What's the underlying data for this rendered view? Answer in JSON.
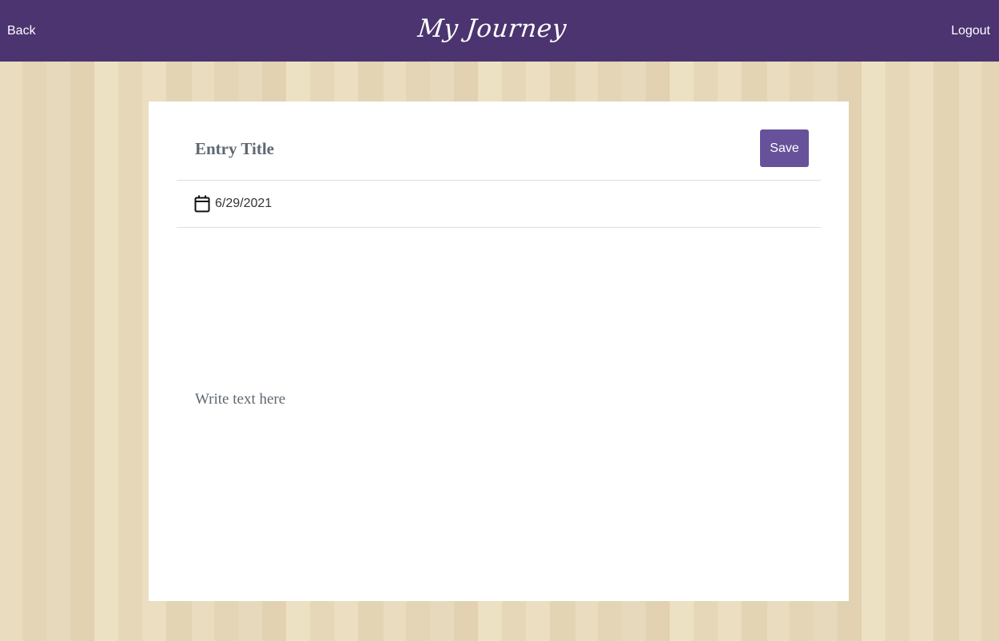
{
  "header": {
    "back_label": "Back",
    "brand": "My Journey",
    "logout_label": "Logout",
    "background_color": "#4b3470"
  },
  "entry": {
    "title_placeholder": "Entry Title",
    "save_label": "Save",
    "date": "6/29/2021",
    "date_icon": "calendar-icon",
    "body_placeholder": "Write text here",
    "accent_color": "#66519a"
  }
}
